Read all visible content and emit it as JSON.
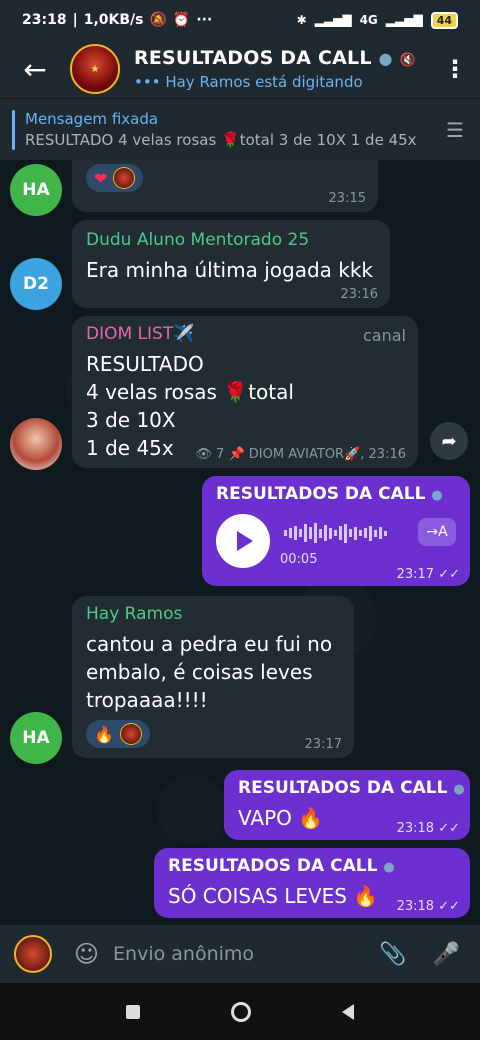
{
  "status": {
    "time": "23:18",
    "net": "1,0KB/s",
    "battery": "44",
    "signal1": "4G",
    "dots": "···"
  },
  "header": {
    "title": "RESULTADOS DA CALL",
    "subtitle": "Hay Ramos está digitando",
    "typing_dots": "•••"
  },
  "pinned": {
    "label": "Mensagem fixada",
    "text": "RESULTADO  4 velas rosas 🌹total  3 de 10X 1 de 45x"
  },
  "messages": {
    "m1": {
      "avatar": "HA",
      "time": "23:15"
    },
    "m2": {
      "avatar": "D2",
      "sender": "Dudu Aluno Mentorado 25",
      "text": "Era minha última jogada kkk",
      "time": "23:16"
    },
    "m3": {
      "sender": "DIOM LIST✈️",
      "tag": "canal",
      "line1": "RESULTADO",
      "line2": "4 velas rosas 🌹total",
      "line3": "3 de 10X",
      "line4": "1 de 45x",
      "views": "7",
      "footer": "DIOM AVIATOR🚀, 23:16"
    },
    "m4": {
      "sender": "RESULTADOS DA CALL",
      "duration": "00:05",
      "time": "23:17",
      "transcribe": "→A"
    },
    "m5": {
      "avatar": "HA",
      "sender": "Hay Ramos",
      "line1": "cantou a pedra eu fui no",
      "line2": "embalo, é coisas leves",
      "line3": "tropaaaa!!!!",
      "time": "23:17"
    },
    "m6": {
      "sender": "RESULTADOS DA CALL",
      "text": "VAPO 🔥",
      "time": "23:18"
    },
    "m7": {
      "sender": "RESULTADOS DA CALL",
      "text": "SÓ COISAS LEVES 🔥",
      "time": "23:18"
    }
  },
  "composer": {
    "placeholder": "Envio anônimo"
  },
  "colors": {
    "accent": "#6ab3f3",
    "out_bubble": "#6c2fd0",
    "in_bubble": "#212d33"
  }
}
